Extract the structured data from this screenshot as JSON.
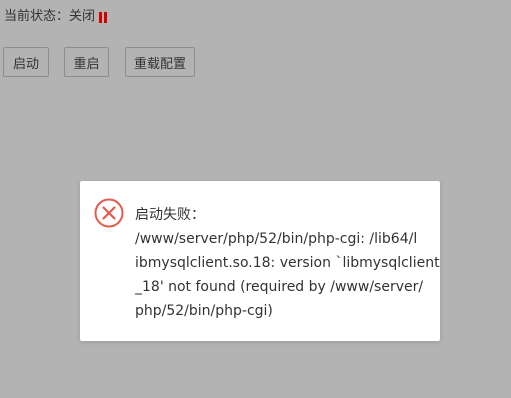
{
  "status": {
    "label": "当前状态：关闭",
    "icon": "pause-icon",
    "icon_color": "#d40000"
  },
  "buttons": {
    "start": "启动",
    "restart": "重启",
    "reload": "重载配置"
  },
  "dialog": {
    "icon": "close-circle-icon",
    "icon_color": "#e45b4d",
    "lines": [
      "启动失败：",
      "/www/server/php/52/bin/php-cgi: /lib64/l",
      "ibmysqlclient.so.18: version `libmysqlclient",
      "_18' not found (required by /www/server/",
      "php/52/bin/php-cgi)"
    ]
  }
}
